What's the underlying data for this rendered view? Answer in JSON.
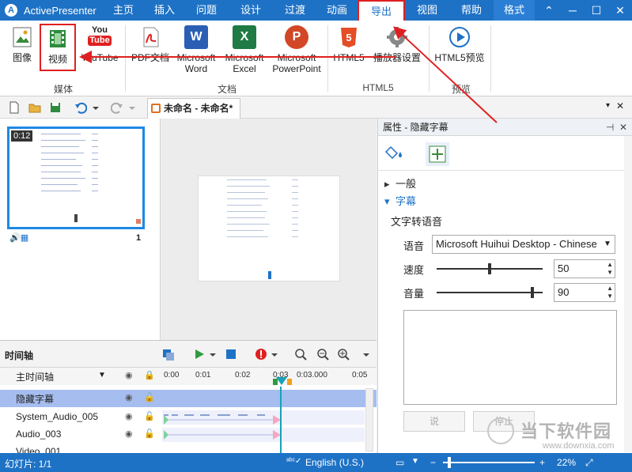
{
  "app": {
    "title": "ActivePresenter",
    "logo_letter": "A"
  },
  "ribbon_tabs": [
    "主页",
    "插入",
    "问题",
    "设计",
    "过渡",
    "动画",
    "导出",
    "视图",
    "帮助",
    "格式"
  ],
  "window_controls": [
    "⌃",
    "─",
    "☐",
    "✕"
  ],
  "ribbon": {
    "buttons": [
      {
        "label": "图像"
      },
      {
        "label": "视频"
      },
      {
        "label": "YouTube"
      },
      {
        "label": "PDF文档"
      },
      {
        "label": "Microsoft Word"
      },
      {
        "label": "Microsoft Excel"
      },
      {
        "label": "Microsoft PowerPoint"
      },
      {
        "label": "HTML5"
      },
      {
        "label": "播放器设置"
      },
      {
        "label": "HTML5预览"
      }
    ],
    "groups": [
      "媒体",
      "文档",
      "HTML5",
      "预览"
    ],
    "icon_letters": {
      "word": "W",
      "excel": "X",
      "powerpoint": "P",
      "html5": "5",
      "youtube_top": "You",
      "youtube_bottom": "Tube"
    }
  },
  "document_tab": {
    "title": "未命名 - 未命名*"
  },
  "slide_panel": {
    "thumb_time": "0:12",
    "slide_number": "1"
  },
  "properties": {
    "title": "属性 - 隐藏字幕",
    "sections": [
      {
        "label": "一般",
        "open": false
      },
      {
        "label": "字幕",
        "open": true
      }
    ],
    "tts_label": "文字转语音",
    "voice_label": "语音",
    "voice_value": "Microsoft Huihui Desktop - Chinese (",
    "speed_label": "速度",
    "speed_value": "50",
    "speed_fraction": 0.5,
    "volume_label": "音量",
    "volume_value": "90",
    "volume_fraction": 0.9,
    "btn_speak": "说",
    "btn_stop": "停止"
  },
  "timeline": {
    "title": "时间轴",
    "main_track": "主时间轴",
    "ruler_ticks": [
      "0:00",
      "0:01",
      "0:02",
      "0:03",
      "0:03.000",
      "0:05"
    ],
    "tracks": [
      {
        "name": "隐藏字幕"
      },
      {
        "name": "System_Audio_005"
      },
      {
        "name": "Audio_003"
      },
      {
        "name": "Video_001"
      }
    ]
  },
  "status": {
    "slide": "幻灯片: 1/1",
    "language": "English (U.S.)",
    "zoom": "22%"
  },
  "watermark": {
    "text": "当下软件园",
    "url": "www.downxia.com"
  },
  "colors": {
    "accent": "#1e72c6",
    "highlight": "#e02020",
    "track_selected": "#a6bdf0"
  }
}
